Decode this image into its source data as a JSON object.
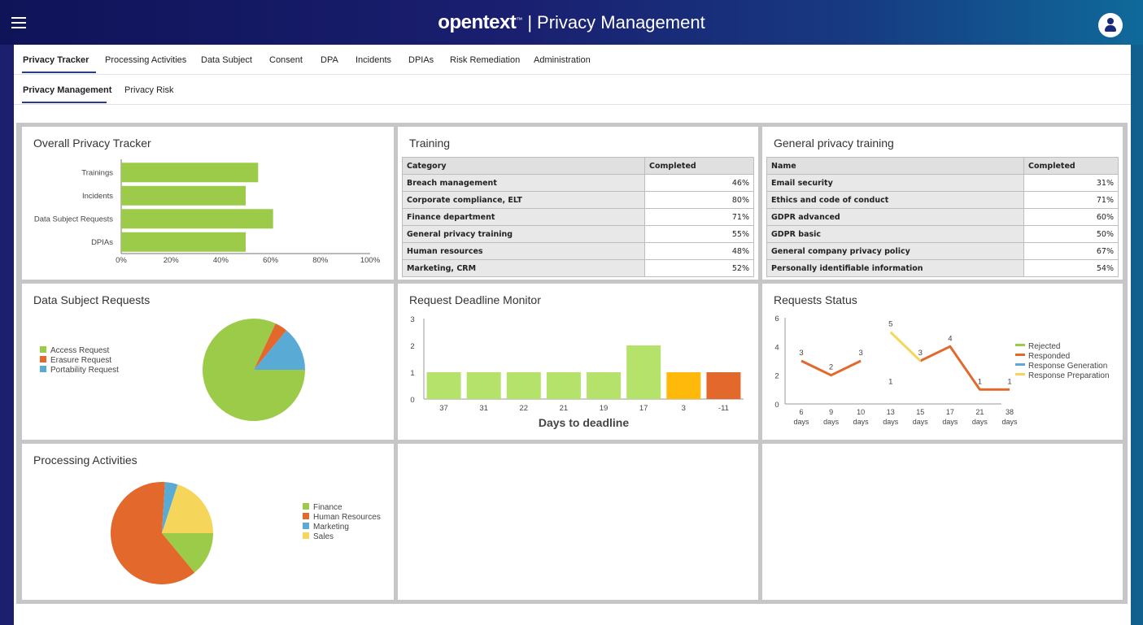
{
  "header": {
    "logo": "opentext",
    "trademark": "™",
    "separator": "|",
    "product": "Privacy Management"
  },
  "nav": {
    "tabs": [
      {
        "label": "Privacy Tracker",
        "active": true
      },
      {
        "label": "Processing Activities"
      },
      {
        "label": "Data Subject"
      },
      {
        "label": "Consent"
      },
      {
        "label": "DPA"
      },
      {
        "label": "Incidents"
      },
      {
        "label": "DPIAs"
      },
      {
        "label": "Risk Remediation"
      },
      {
        "label": "Administration"
      }
    ]
  },
  "subnav": {
    "tabs": [
      {
        "label": "Privacy Management",
        "active": true
      },
      {
        "label": "Privacy Risk"
      }
    ]
  },
  "panels": {
    "overall": {
      "title": "Overall Privacy Tracker",
      "chart_data": {
        "type": "bar",
        "orientation": "horizontal",
        "categories": [
          "Trainings",
          "Incidents",
          "Data Subject Requests",
          "DPIAs"
        ],
        "values": [
          55,
          50,
          61,
          50
        ],
        "xlim": [
          0,
          100
        ],
        "xticks": [
          "0%",
          "20%",
          "40%",
          "60%",
          "80%",
          "100%"
        ],
        "color": "#9ccb4a"
      }
    },
    "training": {
      "title": "Training",
      "columns": [
        "Category",
        "Completed"
      ],
      "rows": [
        [
          "Breach management",
          "46%"
        ],
        [
          "Corporate compliance, ELT",
          "80%"
        ],
        [
          "Finance department",
          "71%"
        ],
        [
          "General privacy training",
          "55%"
        ],
        [
          "Human resources",
          "48%"
        ],
        [
          "Marketing, CRM",
          "52%"
        ]
      ]
    },
    "general": {
      "title": "General privacy training",
      "columns": [
        "Name",
        "Completed"
      ],
      "rows": [
        [
          "Email security",
          "31%"
        ],
        [
          "Ethics and code of conduct",
          "71%"
        ],
        [
          "GDPR advanced",
          "60%"
        ],
        [
          "GDPR basic",
          "50%"
        ],
        [
          "General company privacy policy",
          "67%"
        ],
        [
          "Personally identifiable information",
          "54%"
        ]
      ]
    },
    "dsr": {
      "title": "Data Subject Requests",
      "chart_data": {
        "type": "pie",
        "labels": [
          "Access Request",
          "Erasure Request",
          "Portability Request"
        ],
        "values": [
          82,
          4,
          14
        ],
        "colors": [
          "#9ccb4a",
          "#e2692b",
          "#5aaad6"
        ]
      }
    },
    "deadline": {
      "title": "Request Deadline Monitor",
      "chart_data": {
        "type": "bar",
        "categories": [
          "37",
          "31",
          "22",
          "21",
          "19",
          "17",
          "3",
          "-11"
        ],
        "values": [
          1,
          1,
          1,
          1,
          1,
          2,
          1,
          1
        ],
        "colors": [
          "#b5e26a",
          "#b5e26a",
          "#b5e26a",
          "#b5e26a",
          "#b5e26a",
          "#b5e26a",
          "#ffb90b",
          "#e2692b"
        ],
        "ylim": [
          0,
          3
        ],
        "yticks": [
          "0",
          "1",
          "2",
          "3"
        ],
        "xlabel": "Days to deadline"
      }
    },
    "status": {
      "title": "Requests Status",
      "chart_data": {
        "type": "line",
        "x": [
          "6 days",
          "9 days",
          "10 days",
          "13 days",
          "15 days",
          "17 days",
          "21 days",
          "38 days"
        ],
        "ylim": [
          0,
          6
        ],
        "yticks": [
          "0",
          "2",
          "4",
          "6"
        ],
        "series": [
          {
            "name": "Rejected",
            "color": "#9ccb4a",
            "values": []
          },
          {
            "name": "Responded",
            "color": "#e2692b",
            "values": [
              3,
              2,
              3,
              null,
              3,
              4,
              1,
              1
            ]
          },
          {
            "name": "Response Generation",
            "color": "#5aaad6",
            "values": []
          },
          {
            "name": "Response Preparation",
            "color": "#f5d55a",
            "values": [
              null,
              null,
              null,
              5,
              3,
              null,
              null,
              null
            ]
          }
        ],
        "annotations": [
          {
            "x": "6 days",
            "y": 3,
            "text": "3"
          },
          {
            "x": "9 days",
            "y": 2,
            "text": "2"
          },
          {
            "x": "10 days",
            "y": 3,
            "text": "3"
          },
          {
            "x": "13 days",
            "y": 5,
            "text": "5"
          },
          {
            "x": "13 days",
            "y": 1,
            "text": "1"
          },
          {
            "x": "15 days",
            "y": 3,
            "text": "3"
          },
          {
            "x": "17 days",
            "y": 4,
            "text": "4"
          },
          {
            "x": "21 days",
            "y": 1,
            "text": "1"
          },
          {
            "x": "38 days",
            "y": 1,
            "text": "1"
          }
        ]
      }
    },
    "processing": {
      "title": "Processing Activities",
      "chart_data": {
        "type": "pie",
        "labels": [
          "Finance",
          "Human Resources",
          "Marketing",
          "Sales"
        ],
        "values": [
          14,
          62,
          4,
          20
        ],
        "colors": [
          "#9ccb4a",
          "#e2692b",
          "#5aaad6",
          "#f5d55a"
        ]
      }
    }
  }
}
